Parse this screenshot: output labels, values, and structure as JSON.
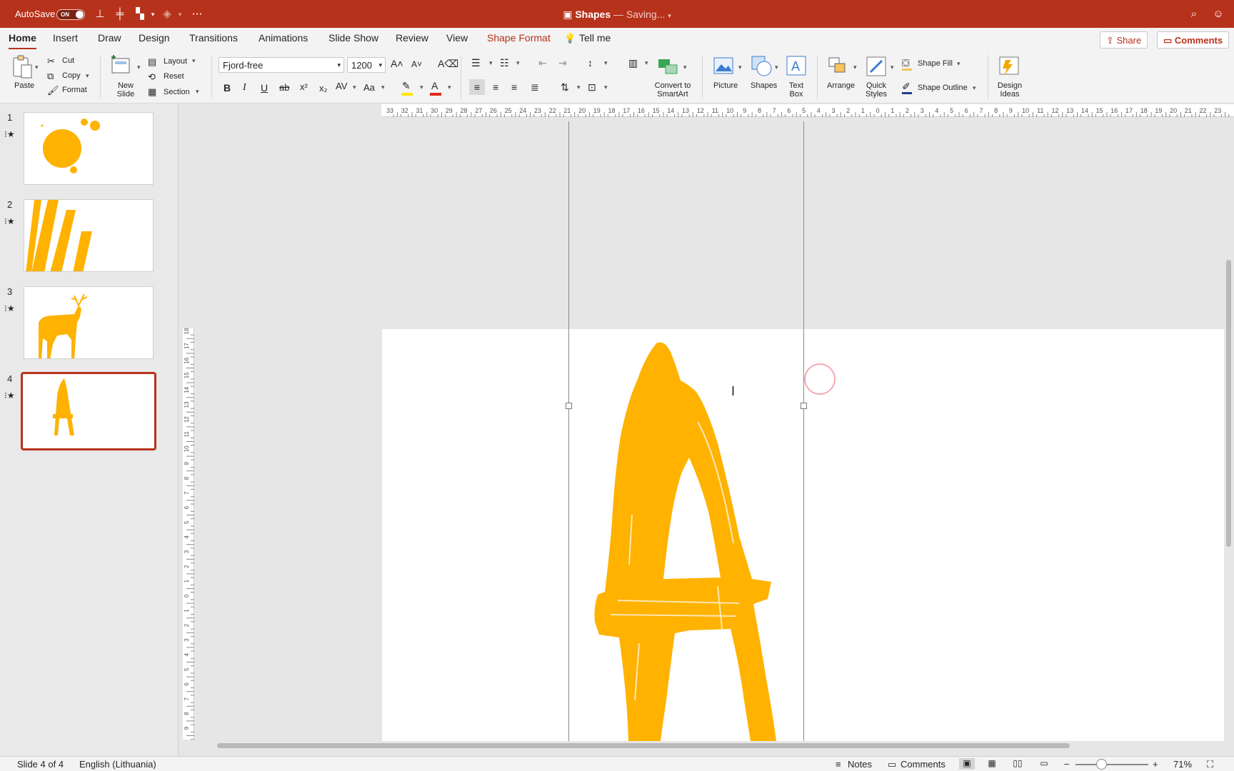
{
  "titlebar": {
    "autosave_label": "AutoSave",
    "autosave_state": "ON",
    "doc_name": "Shapes",
    "doc_status": "— Saving...",
    "accent_color": "#b7321b"
  },
  "tabs": [
    {
      "label": "Home"
    },
    {
      "label": "Insert"
    },
    {
      "label": "Draw"
    },
    {
      "label": "Design"
    },
    {
      "label": "Transitions"
    },
    {
      "label": "Animations"
    },
    {
      "label": "Slide Show"
    },
    {
      "label": "Review"
    },
    {
      "label": "View"
    },
    {
      "label": "Shape Format"
    },
    {
      "label": "Tell me"
    }
  ],
  "active_tab": "Home",
  "actions": {
    "share": "Share",
    "comments": "Comments"
  },
  "ribbon": {
    "paste": "Paste",
    "cut": "Cut",
    "copy": "Copy",
    "format": "Format",
    "new_slide_1": "New",
    "new_slide_2": "Slide",
    "layout": "Layout",
    "reset": "Reset",
    "section": "Section",
    "font_name": "Fjord-free",
    "font_size": "1200",
    "convert_1": "Convert to",
    "convert_2": "SmartArt",
    "picture": "Picture",
    "shapes": "Shapes",
    "text_box_1": "Text",
    "text_box_2": "Box",
    "arrange": "Arrange",
    "quick_styles_1": "Quick",
    "quick_styles_2": "Styles",
    "shape_fill": "Shape Fill",
    "shape_outline": "Shape Outline",
    "design_ideas_1": "Design",
    "design_ideas_2": "Ideas"
  },
  "slides": [
    {
      "number": "1",
      "content": "circles"
    },
    {
      "number": "2",
      "content": "stripes"
    },
    {
      "number": "3",
      "content": "deer"
    },
    {
      "number": "4",
      "content": "letter-a",
      "selected": true
    }
  ],
  "shape_color": "#ffb200",
  "ruler": {
    "horizontal_ticks": [
      "33",
      "32",
      "31",
      "30",
      "29",
      "28",
      "27",
      "26",
      "25",
      "24",
      "23",
      "22",
      "21",
      "20",
      "19",
      "18",
      "17",
      "16",
      "15",
      "14",
      "13",
      "12",
      "11",
      "10",
      "9",
      "8",
      "7",
      "6",
      "5",
      "4",
      "3",
      "2",
      "1",
      "0",
      "1",
      "2",
      "3",
      "4",
      "5",
      "6",
      "7",
      "8",
      "9",
      "10",
      "11",
      "12",
      "13",
      "14",
      "15",
      "16",
      "17",
      "18",
      "19",
      "20",
      "21",
      "22",
      "23"
    ],
    "vertical_ticks": [
      "18",
      "17",
      "16",
      "15",
      "14",
      "13",
      "12",
      "11",
      "10",
      "9",
      "8",
      "7",
      "6",
      "5",
      "4",
      "3",
      "2",
      "1",
      "0",
      "1",
      "2",
      "3",
      "4",
      "5",
      "6",
      "7",
      "8",
      "9"
    ]
  },
  "status": {
    "slide_info": "Slide 4 of 4",
    "language": "English (Lithuania)",
    "notes": "Notes",
    "comments": "Comments",
    "zoom": "71%"
  }
}
